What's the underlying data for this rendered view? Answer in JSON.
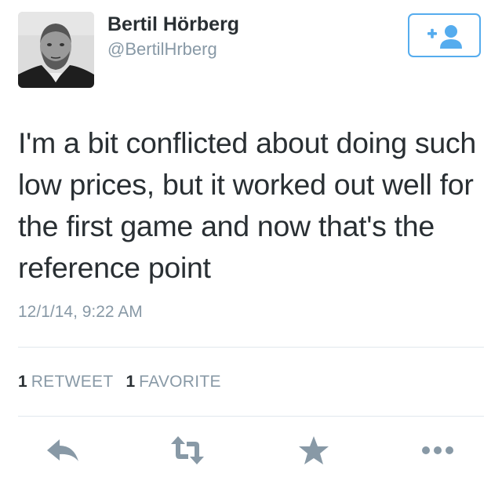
{
  "user": {
    "display_name": "Bertil Hörberg",
    "handle": "@BertilHrberg",
    "avatar_icon": "profile-photo"
  },
  "follow_button": {
    "icon": "follow-user-icon",
    "color": "#55acee"
  },
  "tweet": {
    "text": "I'm a bit conflicted about doing such low prices, but it worked out well for the first game and now that's the reference point",
    "timestamp": "12/1/14, 9:22 AM"
  },
  "stats": {
    "retweet_count": "1",
    "retweet_label": "RETWEET",
    "favorite_count": "1",
    "favorite_label": "FAVORITE"
  },
  "actions": {
    "reply_icon": "reply-icon",
    "retweet_icon": "retweet-icon",
    "favorite_icon": "star-icon",
    "more_icon": "more-icon",
    "icon_color": "#8899a6"
  },
  "colors": {
    "text": "#292f33",
    "muted": "#8899a6",
    "accent": "#55acee",
    "divider": "#e1e8ed"
  }
}
